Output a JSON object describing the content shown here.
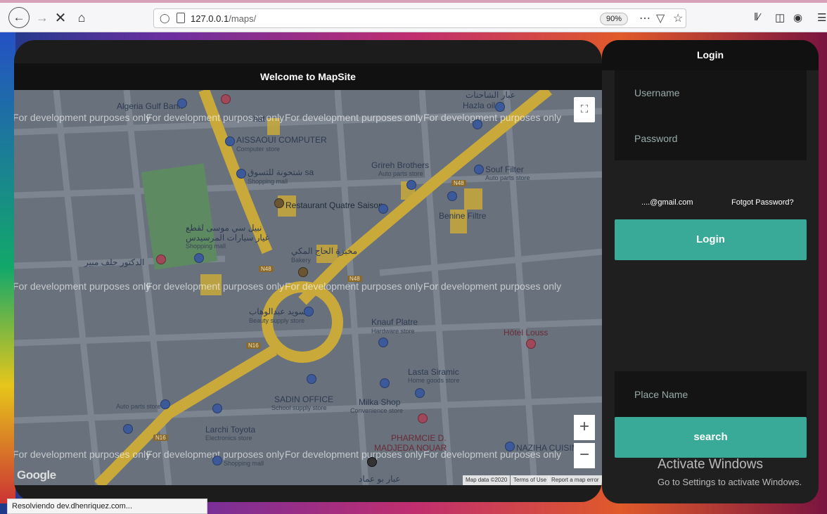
{
  "browser": {
    "url_host": "127.0.0.1",
    "url_path": "/maps/",
    "zoom": "90%",
    "status_text": "Resolviendo dev.dhenriquez.com..."
  },
  "map_panel": {
    "title": "Welcome to MapSite",
    "watermark": "For development purposes only",
    "places": {
      "algeria_gulf_bank": "Algeria Gulf Bank",
      "aissaoui": "AISSAOUI COMPUTER",
      "aissaoui_sub": "Computer store",
      "sa_ar": "شتحونة للتسوق sa",
      "sa_sub": "Shopping mall",
      "restaurant": "Restaurant Quatre Saison",
      "grireh": "Grireh Brothers",
      "grireh_sub": "Auto parts store",
      "souf": "Souf Filter",
      "souf_sub": "Auto parts store",
      "benine": "Benine Filtre",
      "hazla": "Hazla oil",
      "hazla_ar": "عبار الشاحنات",
      "mall_ar1": "نبيل سي موسى لقطع",
      "mall_ar2": "غيار سيارات المرسيدس",
      "mall_ar_sub": "Shopping mall",
      "doctor_ar": "الدكتور حلف مبير",
      "bakery_ar": "مخبزة الحاج المكي",
      "bakery_sub": "Bakery",
      "beauty_ar": "سويد عبدالوهاب",
      "beauty_sub": "Beauty supply store",
      "knauf": "Knauf Platre",
      "knauf_sub": "Hardware store",
      "hotel": "Hôtel Louss",
      "lasta": "Lasta Siramic",
      "lasta_sub": "Home goods store",
      "sadin": "SADIN OFFICE",
      "sadin_sub": "School supply store",
      "milka": "Milka Shop",
      "milka_sub": "Convenience store",
      "auto_parts": "Auto parts store",
      "larchi": "Larchi Toyota",
      "larchi_sub": "Electronics store",
      "pharmacie1": "PHARMCIE D.",
      "pharmacie2": "MADJEDA NOUAR",
      "naziha": "NAZIHA CUISINE",
      "ar_bottom": "عبار بو عماد",
      "shopping_sub": "Shopping mall",
      "nat": "hat"
    },
    "roads": {
      "n48": "N48",
      "n16": "N16"
    },
    "google": "Google",
    "map_data": "Map data ©2020",
    "terms": "Terms of Use",
    "report": "Report a map error"
  },
  "login_panel": {
    "title": "Login",
    "username_placeholder": "Username",
    "password_placeholder": "Password",
    "email": "....@gmail.com",
    "forgot": "Fotgot Password?",
    "login_button": "Login",
    "place_placeholder": "Place Name",
    "search_button": "search"
  },
  "overlay": {
    "activate_title": "Activate Windows",
    "activate_sub": "Go to Settings to activate Windows."
  }
}
